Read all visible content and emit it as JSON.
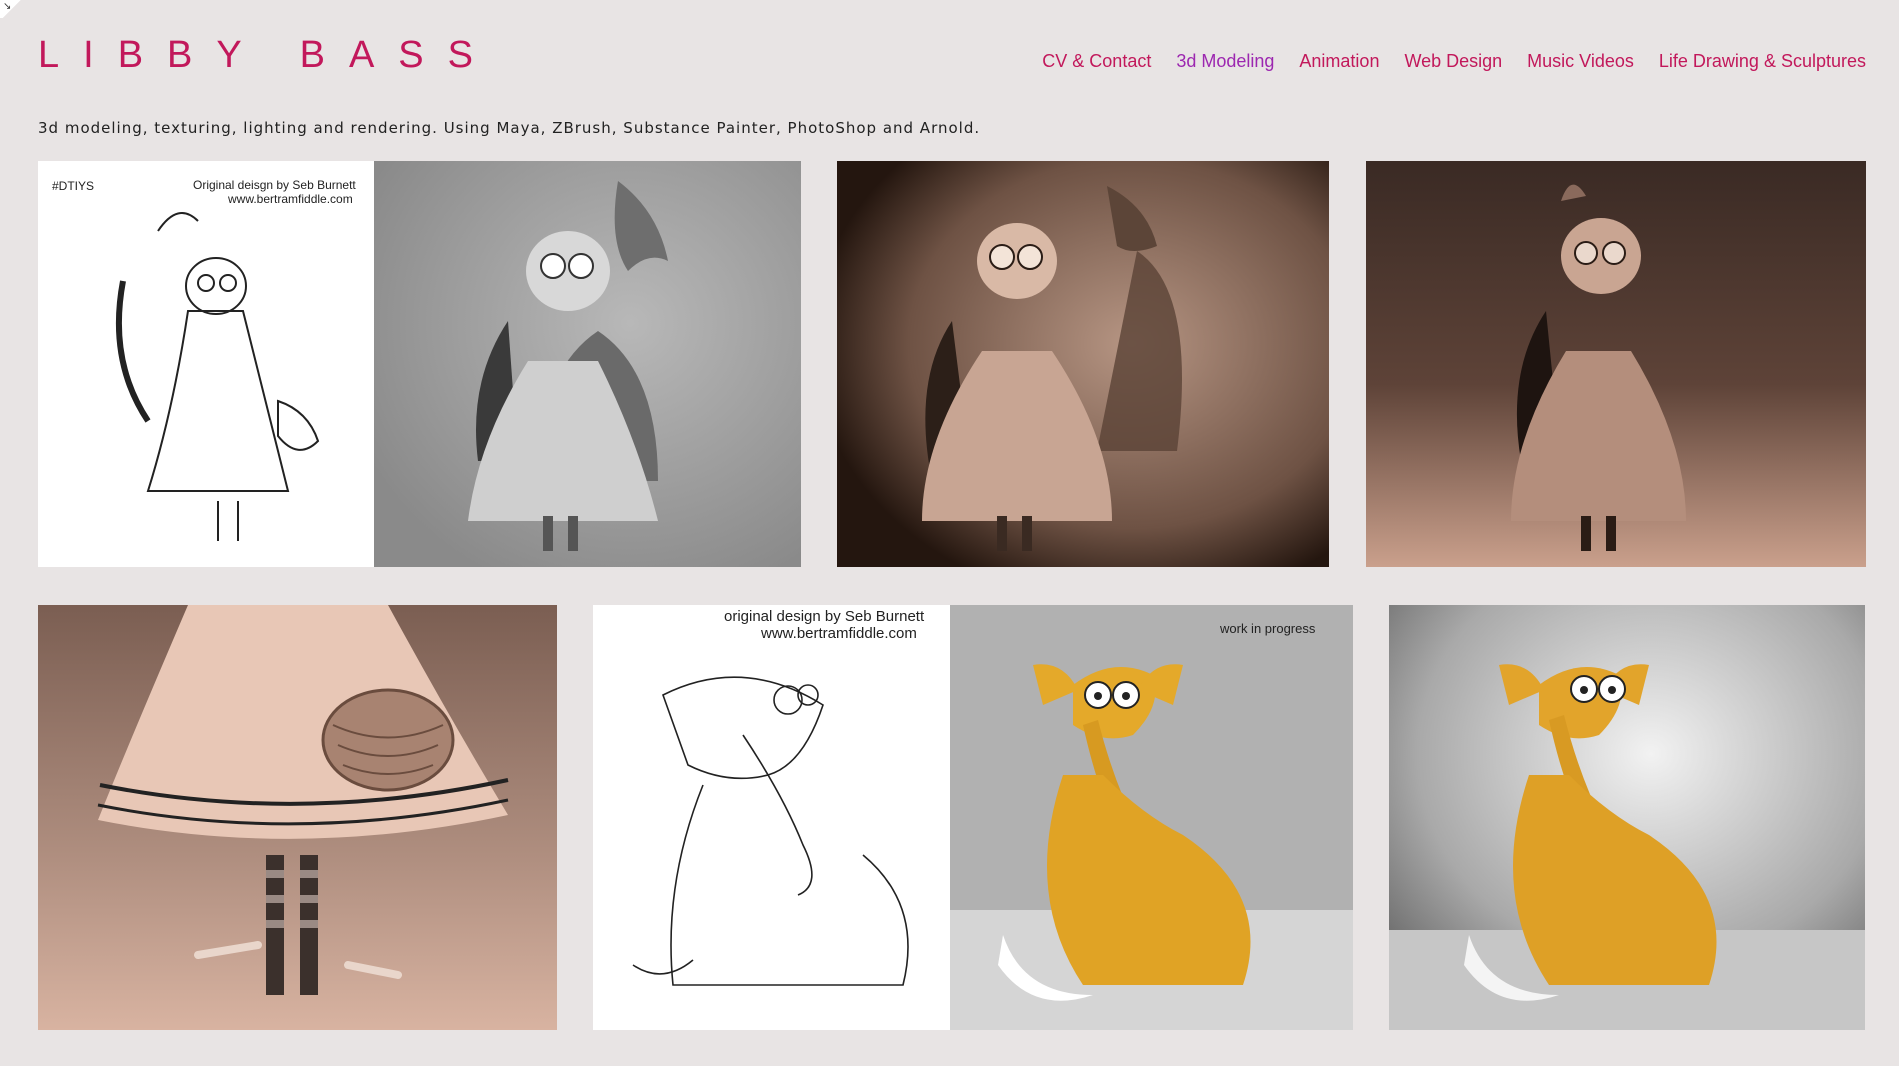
{
  "header": {
    "site_title": "LIBBY BASS",
    "corner_icon": "resize-arrow-icon"
  },
  "nav": {
    "items": [
      {
        "label": "CV & Contact",
        "active": false
      },
      {
        "label": "3d Modeling",
        "active": true
      },
      {
        "label": "Animation",
        "active": false
      },
      {
        "label": "Web Design",
        "active": false
      },
      {
        "label": "Music Videos",
        "active": false
      },
      {
        "label": "Life Drawing & Sculptures",
        "active": false
      }
    ]
  },
  "intro": {
    "text": "3d modeling, texturing, lighting and rendering. Using Maya, ZBrush, Substance Painter, PhotoShop and Arnold."
  },
  "gallery": {
    "tiles": [
      {
        "name": "alice-vulture-sketch-and-clay",
        "tag": "#DTIYS",
        "credit_line1": "Original deisgn by Seb Burnett",
        "credit_line2": "www.bertramfiddle.com"
      },
      {
        "name": "alice-vulture-sepia-render"
      },
      {
        "name": "alice-vulture-dark-render"
      },
      {
        "name": "alice-basket-closeup"
      },
      {
        "name": "fox-sketch-and-render",
        "credit_line1": "original design by Seb Burnett",
        "credit_line2": "www.bertramfiddle.com",
        "status": "work in progress"
      },
      {
        "name": "fox-final-render"
      }
    ]
  },
  "colors": {
    "background": "#e8e4e4",
    "brand": "#c2185b",
    "active_nav": "#9c27b0"
  }
}
